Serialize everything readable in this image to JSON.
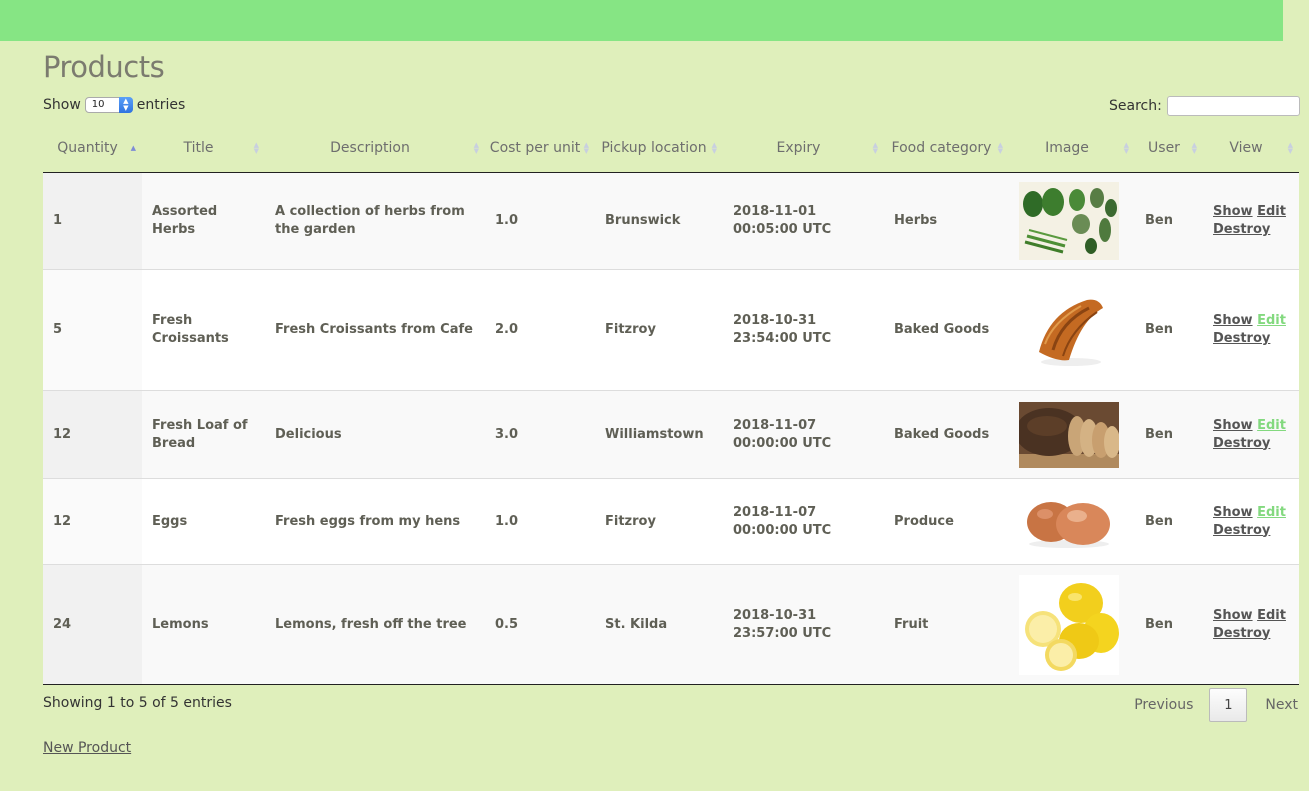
{
  "page_title": "Products",
  "length_control": {
    "show_label": "Show",
    "value": "10",
    "entries_label": "entries"
  },
  "search": {
    "label": "Search:",
    "value": ""
  },
  "columns": [
    "Quantity",
    "Title",
    "Description",
    "Cost per unit",
    "Pickup location",
    "Expiry",
    "Food category",
    "Image",
    "User",
    "View"
  ],
  "sorted_column": "Quantity",
  "rows": [
    {
      "quantity": "1",
      "title": "Assorted Herbs",
      "description": "A collection of herbs from the garden",
      "cost": "1.0",
      "location": "Brunswick",
      "expiry": "2018-11-01 00:05:00 UTC",
      "category": "Herbs",
      "image": "herbs-image",
      "user": "Ben",
      "show": "Show",
      "edit": "Edit",
      "destroy": "Destroy",
      "edit_visited": false
    },
    {
      "quantity": "5",
      "title": "Fresh Croissants",
      "description": "Fresh Croissants from Cafe",
      "cost": "2.0",
      "location": "Fitzroy",
      "expiry": "2018-10-31 23:54:00 UTC",
      "category": "Baked Goods",
      "image": "croissant-image",
      "user": "Ben",
      "show": "Show",
      "edit": "Edit",
      "destroy": "Destroy",
      "edit_visited": true
    },
    {
      "quantity": "12",
      "title": "Fresh Loaf of Bread",
      "description": "Delicious",
      "cost": "3.0",
      "location": "Williamstown",
      "expiry": "2018-11-07 00:00:00 UTC",
      "category": "Baked Goods",
      "image": "bread-image",
      "user": "Ben",
      "show": "Show",
      "edit": "Edit",
      "destroy": "Destroy",
      "edit_visited": true
    },
    {
      "quantity": "12",
      "title": "Eggs",
      "description": "Fresh eggs from my hens",
      "cost": "1.0",
      "location": "Fitzroy",
      "expiry": "2018-11-07 00:00:00 UTC",
      "category": "Produce",
      "image": "eggs-image",
      "user": "Ben",
      "show": "Show",
      "edit": "Edit",
      "destroy": "Destroy",
      "edit_visited": true
    },
    {
      "quantity": "24",
      "title": "Lemons",
      "description": "Lemons, fresh off the tree",
      "cost": "0.5",
      "location": "St. Kilda",
      "expiry": "2018-10-31 23:57:00 UTC",
      "category": "Fruit",
      "image": "lemons-image",
      "user": "Ben",
      "show": "Show",
      "edit": "Edit",
      "destroy": "Destroy",
      "edit_visited": false
    }
  ],
  "info": "Showing 1 to 5 of 5 entries",
  "pagination": {
    "previous": "Previous",
    "current": "1",
    "next": "Next"
  },
  "new_product_link": "New Product",
  "colors": {
    "topbar": "#86e584",
    "background": "#dfefbb",
    "visited_link": "#83d97f"
  }
}
